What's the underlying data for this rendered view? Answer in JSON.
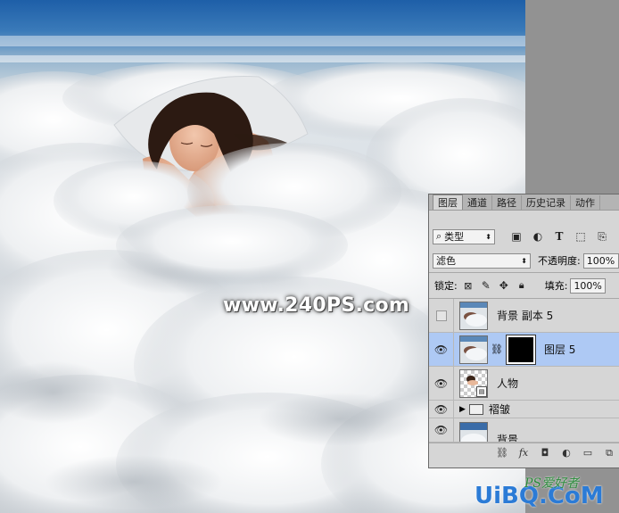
{
  "watermark": "www.240PS.com",
  "brand": {
    "main": "UiBQ.CoM",
    "sub": "PS爱好者"
  },
  "panel": {
    "tabs": [
      "图层",
      "通道",
      "路径",
      "历史记录",
      "动作"
    ],
    "filter_kind": "类型",
    "blend_mode": "滤色",
    "opacity_label": "不透明度:",
    "opacity_value": "100%",
    "lock_label": "锁定:",
    "fill_label": "填充:",
    "fill_value": "100%",
    "layers": [
      {
        "name": "背景 副本 5",
        "visible": false,
        "selected": false,
        "thumb": "clouds"
      },
      {
        "name": "图层 5",
        "visible": true,
        "selected": true,
        "thumb": "clouds",
        "mask": true
      },
      {
        "name": "人物",
        "visible": true,
        "selected": false,
        "thumb": "person"
      },
      {
        "name": "褶皱",
        "visible": true,
        "selected": false,
        "thumb": "folder"
      },
      {
        "name": "背景",
        "visible": true,
        "selected": false,
        "thumb": "clouds"
      }
    ]
  },
  "icons": {
    "filter_search": "search-icon",
    "eye": "eye-icon",
    "link": "link-chain-icon",
    "folder": "folder-icon",
    "smart_object": "smart-object-icon"
  },
  "colors": {
    "selected_row": "#aec9f4",
    "panel_bg": "#d6d6d6"
  }
}
